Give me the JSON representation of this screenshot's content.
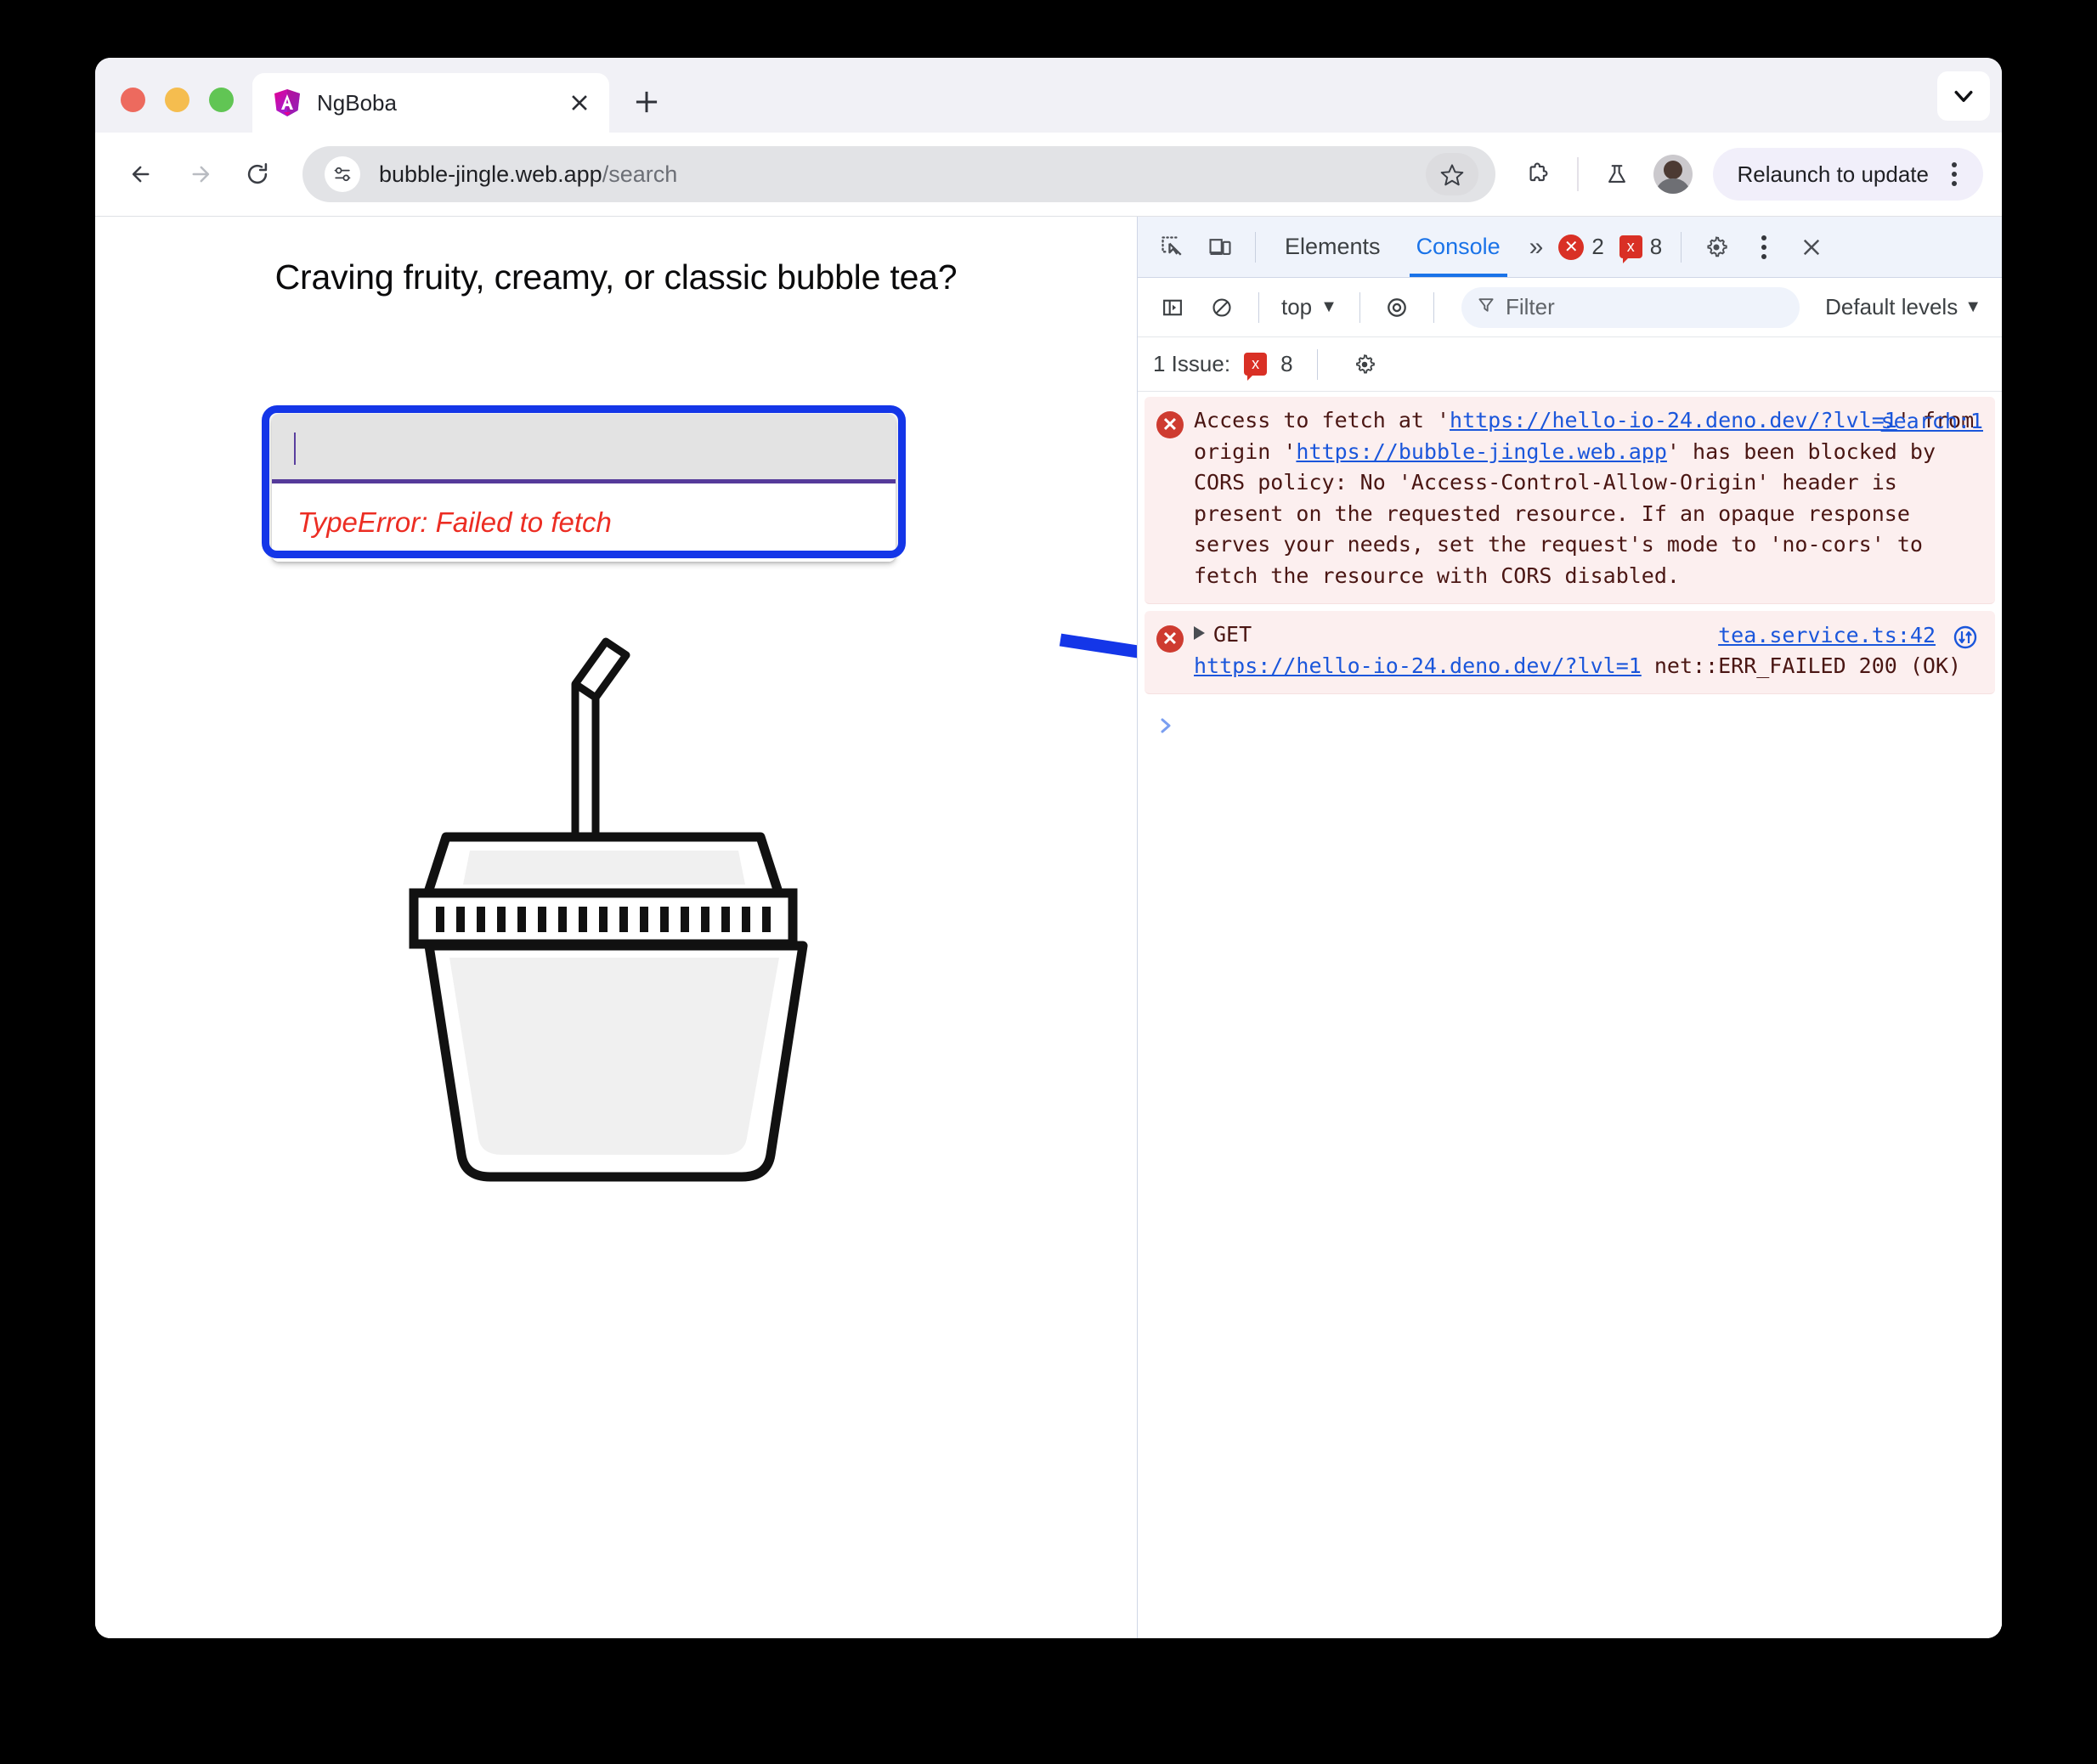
{
  "browser": {
    "tab": {
      "title": "NgBoba",
      "favicon_icon": "angular-logo-icon",
      "close_icon": "close-icon"
    },
    "new_tab_icon": "plus-icon",
    "tabstrip_chevron_icon": "chevron-down-icon",
    "toolbar": {
      "back_icon": "arrow-left-icon",
      "forward_icon": "arrow-right-icon",
      "reload_icon": "reload-icon",
      "site_info_icon": "tune-settings-icon",
      "url_host": "bubble-jingle.web.app",
      "url_path": "/search",
      "bookmark_icon": "star-icon",
      "extensions_icon": "extensions-puzzle-icon",
      "experiments_icon": "flask-icon",
      "avatar_icon": "profile-avatar",
      "relaunch_label": "Relaunch to update",
      "menu_icon": "kebab-menu-icon"
    }
  },
  "page": {
    "heading": "Craving fruity, creamy, or classic bubble tea?",
    "search": {
      "value": "",
      "placeholder": ""
    },
    "error_text": "TypeError: Failed to fetch",
    "illustration_name": "bubble-tea-cup-illustration",
    "annotation_arrow_icon": "blue-arrow-icon",
    "colors": {
      "highlight_border": "#1436e8",
      "error_text": "#ec2d23",
      "field_underline": "#553a9a",
      "field_background": "#e3e3e3"
    }
  },
  "devtools": {
    "tabbar": {
      "inspect_icon": "inspect-element-icon",
      "device_icon": "device-toolbar-icon",
      "tabs": [
        {
          "label": "Elements",
          "active": false
        },
        {
          "label": "Console",
          "active": true
        }
      ],
      "more_tabs_label": "»",
      "error_count": "2",
      "warning_count": "8",
      "settings_icon": "gear-icon",
      "menu_icon": "kebab-menu-icon",
      "close_icon": "close-icon"
    },
    "toolbar": {
      "sidebar_icon": "console-sidebar-icon",
      "clear_icon": "clear-console-icon",
      "context_label": "top",
      "context_chevron": "▼",
      "live_expression_icon": "eye-icon",
      "filter_icon": "filter-funnel-icon",
      "filter_value": "",
      "filter_placeholder": "Filter",
      "levels_label": "Default levels",
      "levels_chevron": "▼"
    },
    "issuebar": {
      "label": "1 Issue:",
      "issue_count": "8",
      "settings_icon": "gear-icon"
    },
    "messages": [
      {
        "level": "error",
        "icon": "error-circle-icon",
        "source": "search:1",
        "parts": [
          {
            "text": "Access to fetch at '",
            "link": false
          },
          {
            "text": "https://hello-io-24.deno.dev/?lvl=1",
            "link": true
          },
          {
            "text": "' from origin '",
            "link": false
          },
          {
            "text": "https://bubble-jingle.web.app",
            "link": true
          },
          {
            "text": "' has been blocked by CORS policy: No 'Access-Control-Allow-Origin' header is present on the requested resource. If an opaque response serves your needs, set the request's mode to 'no-cors' to fetch the resource with CORS disabled.",
            "link": false
          }
        ]
      },
      {
        "level": "error",
        "icon": "error-circle-icon",
        "expandable": true,
        "source": "tea.service.ts:42",
        "network_icon": "network-request-icon",
        "parts": [
          {
            "text": "GET",
            "link": false,
            "newline_after": true
          },
          {
            "text": "https://hello-io-24.deno.dev/?lvl=1",
            "link": true
          },
          {
            "text": " net::ERR_FAILED 200 (OK)",
            "link": false
          }
        ]
      }
    ],
    "prompt_chevron": "❯"
  }
}
